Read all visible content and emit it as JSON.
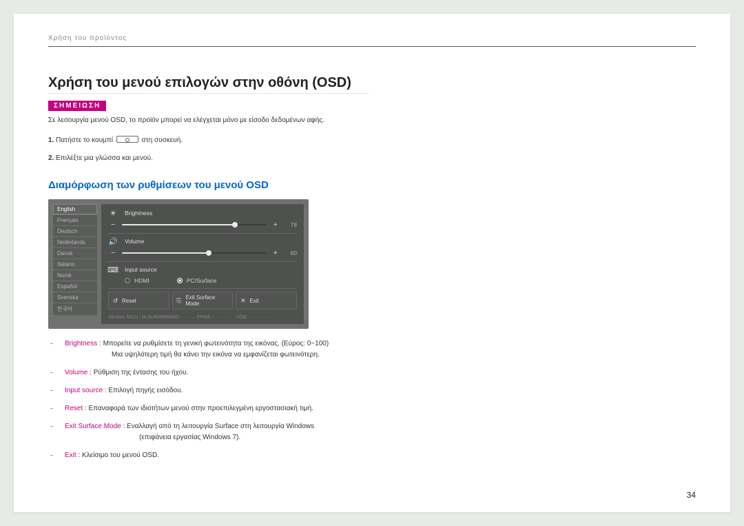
{
  "running_header": "Χρήση του προϊόντος",
  "title": "Χρήση του μενού επιλογών στην οθόνη (OSD)",
  "note": {
    "badge": "ΣΗΜΕΙΩΣΗ",
    "text": "Σε λειτουργία μενού OSD, το προϊόν μπορεί να ελέγχεται μόνο με είσοδο δεδομένων αφής."
  },
  "steps": {
    "s1_num": "1.",
    "s1_a": "Πατήστε το κουμπί ",
    "s1_b": " στη συσκευή.",
    "s2_num": "2.",
    "s2": "Επιλέξτε μια γλώσσα και μενού."
  },
  "subtitle": "Διαμόρφωση των ρυθμίσεων του μενού OSD",
  "osd": {
    "languages": [
      "English",
      "Français",
      "Deutsch",
      "Nederlands",
      "Dansk",
      "Italiano",
      "Norsk",
      "Español",
      "Svenska",
      "한국어"
    ],
    "brightness": {
      "label": "Brightness",
      "value": "78"
    },
    "volume": {
      "label": "Volume",
      "value": "60"
    },
    "input": {
      "label": "Input source",
      "opt1": "HDMI",
      "opt2": "PC/Surface"
    },
    "reset": "Reset",
    "exit_surface": "Exit Surface Mode",
    "exit": "Exit",
    "version": "Version:  MCU : M-SU40MWWAC-· · · · .·   FPGA: · · · · · · · ·   USB:· ·  · · · · . · ·"
  },
  "descriptions": {
    "brightness": {
      "label": "Brightness",
      "text": " : Μπορείτε να ρυθμίσετε τη γενική φωτεινότητα της εικόνας. (Εύρος: 0~100)",
      "sub": "Μια υψηλότερη τιμή θα κάνει την εικόνα να εμφανίζεται φωτεινότερη."
    },
    "volume": {
      "label": "Volume",
      "text": " : Ρύθμιση της έντασης του ήχου."
    },
    "input": {
      "label": "Input source",
      "text": " : Επιλογή πηγής εισόδου."
    },
    "reset": {
      "label": "Reset",
      "text": " : Επαναφορά των ιδιοτήτων μενού στην προεπιλεγμένη εργοστασιακή τιμή."
    },
    "exit_surface": {
      "label": "Exit Surface Mode",
      "text": " : Εναλλαγή από τη λειτουργία Surface στη λειτουργία Windows",
      "sub": "(επιφάνεια εργασίας Windows 7)."
    },
    "exit": {
      "label": "Exit",
      "text": " : Κλείσιμο του μενού OSD."
    }
  },
  "page_number": "34"
}
